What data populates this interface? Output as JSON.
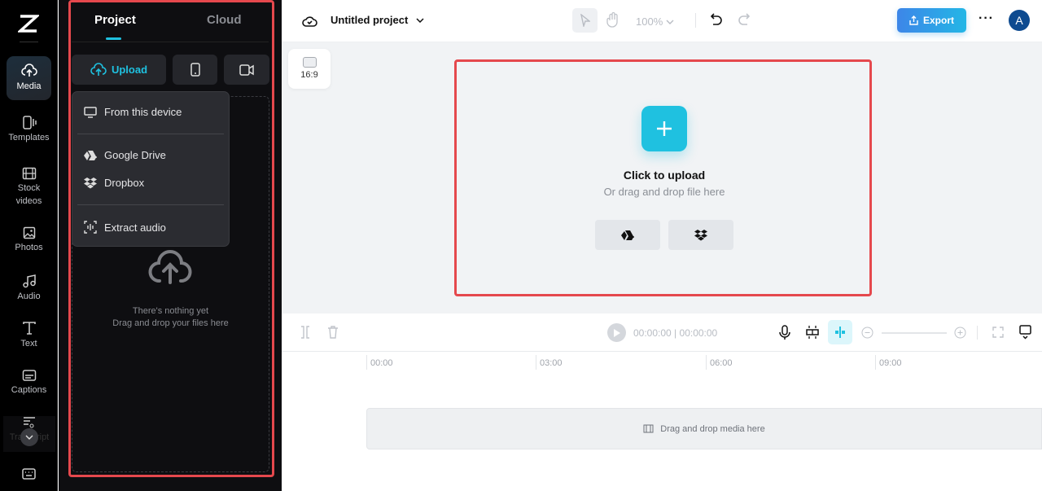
{
  "sidebar": {
    "items": [
      {
        "label": "Media",
        "icon": "cloud-upload-icon",
        "active": true
      },
      {
        "label": "Templates",
        "icon": "templates-icon"
      },
      {
        "label": "Stock videos",
        "icon": "film-icon"
      },
      {
        "label": "Photos",
        "icon": "image-icon"
      },
      {
        "label": "Audio",
        "icon": "music-note-icon"
      },
      {
        "label": "Text",
        "icon": "text-icon"
      },
      {
        "label": "Captions",
        "icon": "captions-icon"
      },
      {
        "label": "Transcript",
        "icon": "transcript-icon"
      }
    ]
  },
  "panel": {
    "tabs": [
      "Project",
      "Cloud"
    ],
    "upload_label": "Upload",
    "menu": [
      "From this device",
      "Google Drive",
      "Dropbox",
      "Extract audio"
    ],
    "empty_title": "There's nothing yet",
    "empty_sub": "Drag and drop your files here"
  },
  "topbar": {
    "project_name": "Untitled project",
    "zoom": "100%",
    "export_label": "Export",
    "avatar": "A"
  },
  "canvas": {
    "ratio": "16:9",
    "upload_title": "Click to upload",
    "upload_sub": "Or drag and drop file here"
  },
  "timeline": {
    "current": "00:00:00",
    "total": "00:00:00",
    "ruler": [
      "00:00",
      "03:00",
      "06:00",
      "09:00"
    ],
    "drop_text": "Drag and drop media here"
  },
  "colors": {
    "accent": "#1fc1e0",
    "highlight": "#e5484d",
    "export": "#2f8cf0"
  }
}
